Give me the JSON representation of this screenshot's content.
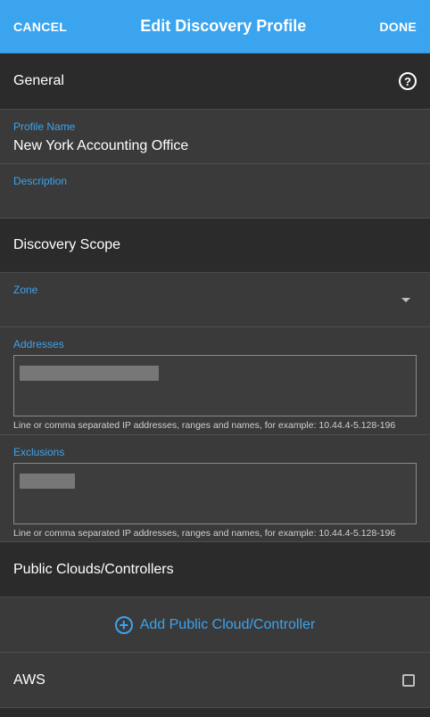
{
  "header": {
    "cancel_label": "CANCEL",
    "title": "Edit Discovery Profile",
    "done_label": "DONE"
  },
  "general": {
    "section_label": "General",
    "help_icon_glyph": "?"
  },
  "profile_name": {
    "label": "Profile Name",
    "value": "New York Accounting Office"
  },
  "description": {
    "label": "Description",
    "value": ""
  },
  "discovery_scope": {
    "section_label": "Discovery Scope"
  },
  "zone": {
    "label": "Zone",
    "value": ""
  },
  "addresses": {
    "label": "Addresses",
    "hint": "Line or comma separated IP addresses, ranges and names, for example: 10.44.4-5.128-196"
  },
  "exclusions": {
    "label": "Exclusions",
    "hint": "Line or comma separated IP addresses, ranges and names, for example: 10.44.4-5.128-196"
  },
  "public_clouds": {
    "section_label": "Public Clouds/Controllers",
    "add_label": "Add Public Cloud/Controller"
  },
  "aws": {
    "label": "AWS",
    "checked": false
  },
  "colors": {
    "accent": "#3ba4ee",
    "background": "#3a3a3a",
    "section_header_bg": "#2b2b2b"
  }
}
